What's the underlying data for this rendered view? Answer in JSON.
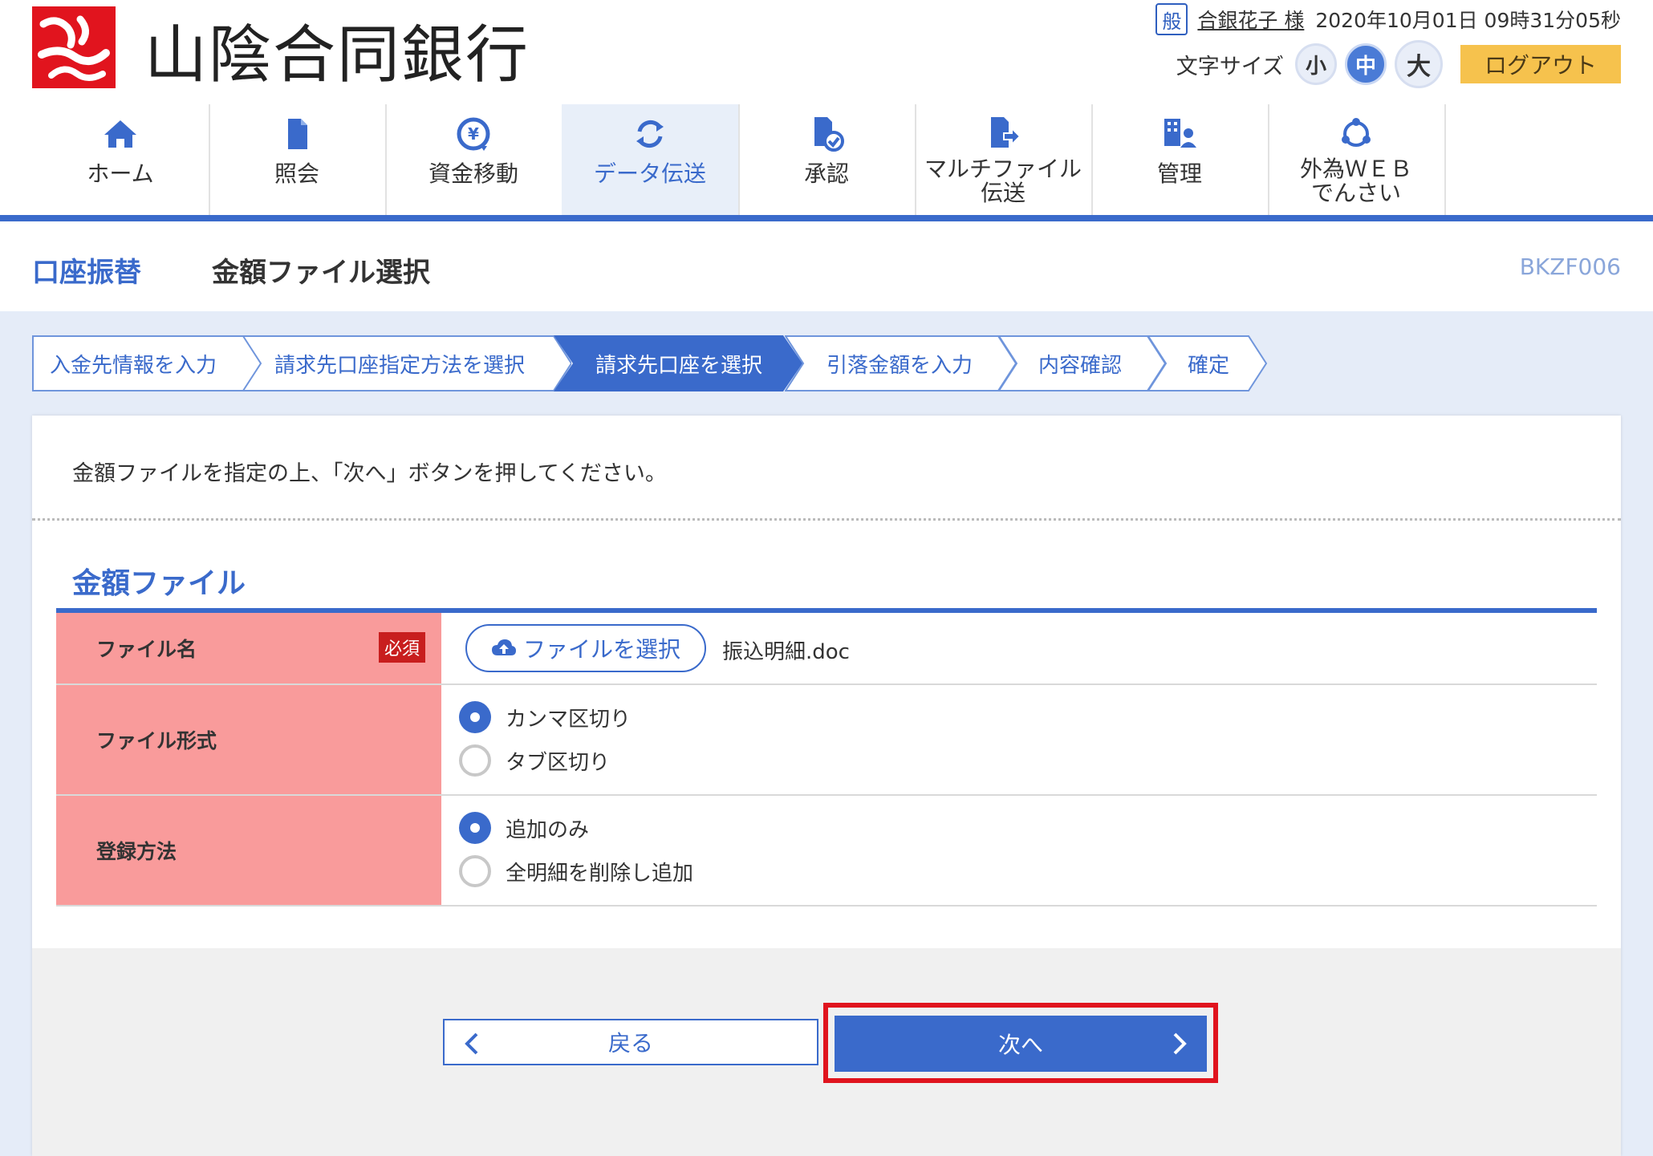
{
  "bank": {
    "name": "山陰合同銀行"
  },
  "user": {
    "kind": "般",
    "name": "合銀花子 様",
    "datetime": "2020年10月01日 09時31分05秒"
  },
  "font_size": {
    "label": "文字サイズ",
    "small": "小",
    "medium": "中",
    "large": "大",
    "selected": "中"
  },
  "logout": "ログアウト",
  "nav": [
    {
      "label": "ホーム",
      "icon": "home-icon"
    },
    {
      "label": "照会",
      "icon": "document-icon"
    },
    {
      "label": "資金移動",
      "icon": "yen-transfer-icon"
    },
    {
      "label": "データ伝送",
      "icon": "sync-icon",
      "active": true
    },
    {
      "label": "承認",
      "icon": "approve-icon"
    },
    {
      "label_line1": "マルチファイル",
      "label_line2": "伝送",
      "icon": "file-send-icon"
    },
    {
      "label": "管理",
      "icon": "admin-icon"
    },
    {
      "label_line1": "外為ＷＥＢ",
      "label_line2": "でんさい",
      "icon": "network-icon"
    }
  ],
  "page": {
    "section": "口座振替",
    "title": "金額ファイル選択",
    "code": "BKZF006"
  },
  "steps": [
    {
      "label": "入金先情報を入力"
    },
    {
      "label": "請求先口座指定方法を選択"
    },
    {
      "label": "請求先口座を選択",
      "current": true
    },
    {
      "label": "引落金額を入力"
    },
    {
      "label": "内容確認"
    },
    {
      "label": "確定"
    }
  ],
  "instruction": "金額ファイルを指定の上、「次へ」ボタンを押してください。",
  "section_heading": "金額ファイル",
  "form": {
    "file": {
      "label": "ファイル名",
      "required": "必須",
      "button": "ファイルを選択",
      "selected_file": "振込明細.doc"
    },
    "format": {
      "label": "ファイル形式",
      "options": [
        "カンマ区切り",
        "タブ区切り"
      ],
      "selected": "カンマ区切り"
    },
    "register": {
      "label": "登録方法",
      "options": [
        "追加のみ",
        "全明細を削除し追加"
      ],
      "selected": "追加のみ"
    }
  },
  "buttons": {
    "back": "戻る",
    "next": "次へ"
  },
  "colors": {
    "brand_red": "#e1141e",
    "primary_blue": "#3a6acb",
    "label_pink": "#f99b9b",
    "logout_yellow": "#f6c24d",
    "highlight_red": "#e0141e"
  }
}
